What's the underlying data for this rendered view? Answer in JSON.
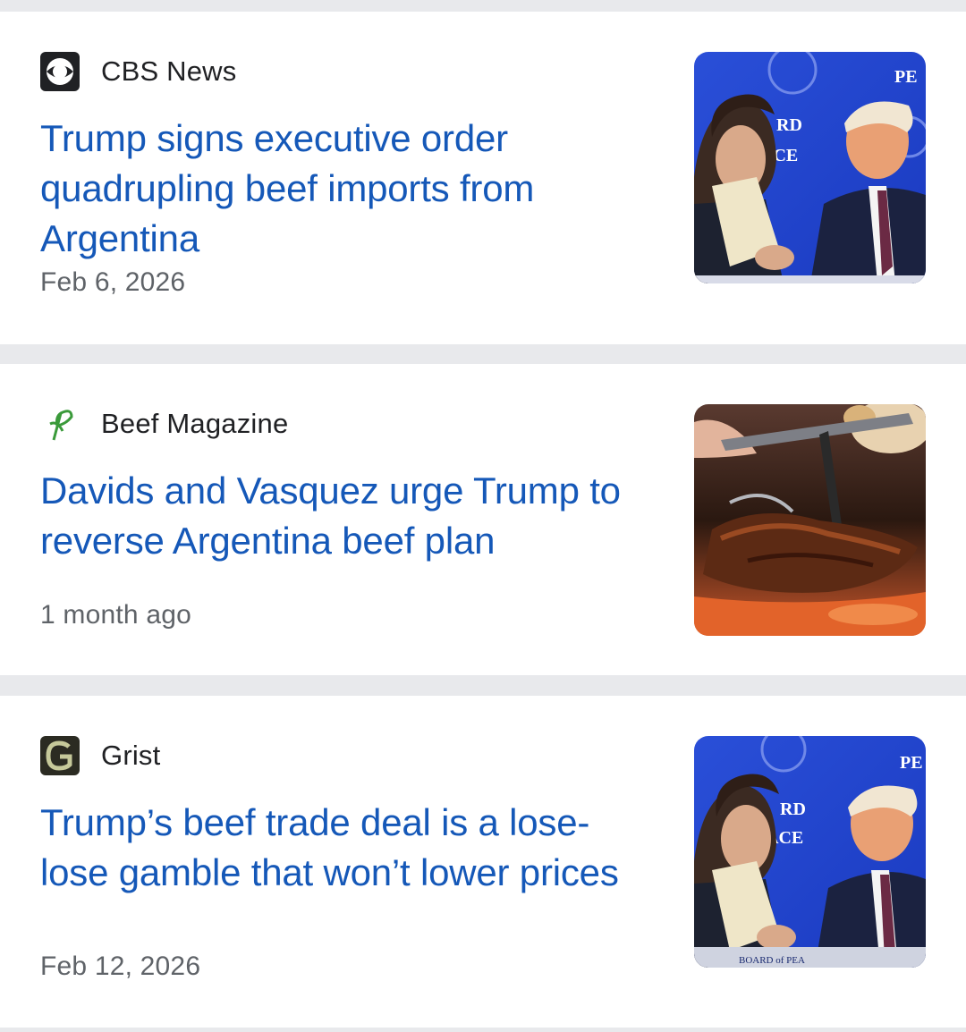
{
  "articles": [
    {
      "source": "CBS News",
      "source_icon": "cbs-eye-logo-icon",
      "title": "Trump signs executive order quadrupling beef imports from Argentina",
      "date": "Feb 6, 2026",
      "image_text": [
        "RD",
        "ACE",
        "PE"
      ]
    },
    {
      "source": "Beef Magazine",
      "source_icon": "green-leaf-logo-icon",
      "title": "Davids and Vasquez urge Trump to reverse Argentina beef plan",
      "date": "1 month ago"
    },
    {
      "source": "Grist",
      "source_icon": "grist-g-logo-icon",
      "title": "Trump’s beef trade deal is a lose-lose gamble that won’t lower prices",
      "date": "Feb 12, 2026",
      "image_text": [
        "RD",
        "ACE",
        "PE",
        "BOARD of PEA"
      ]
    }
  ],
  "colors": {
    "headline": "#1558b8",
    "background": "#e8e9ec",
    "date": "#5f6368"
  }
}
